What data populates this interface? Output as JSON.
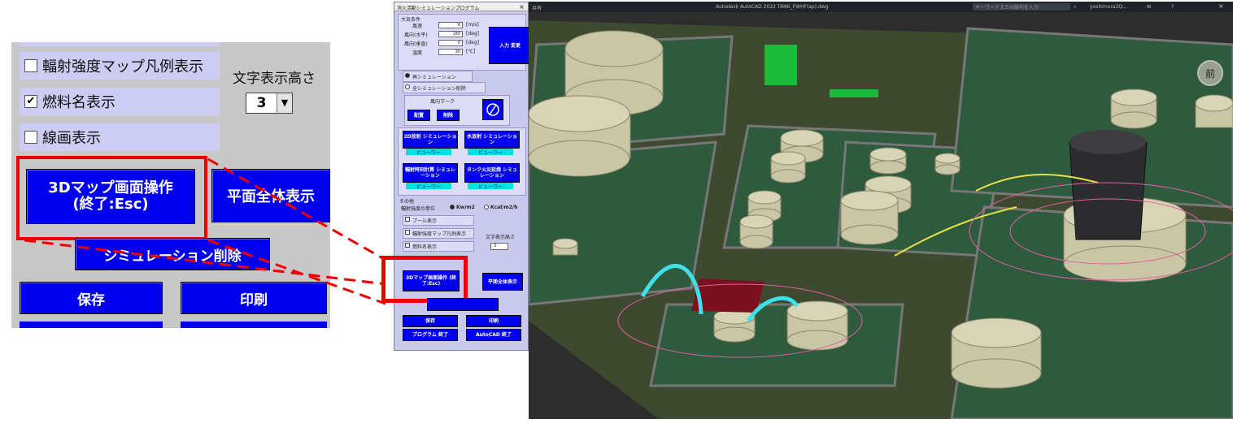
{
  "zoom": {
    "legend_checkbox_label": "輻射強度マップ凡例表示",
    "legend_checked": false,
    "fuel_checkbox_label": "燃料名表示",
    "fuel_checked": true,
    "line_checkbox_label": "線画表示",
    "line_checked": false,
    "text_height_label": "文字表示高さ",
    "text_height_value": "3",
    "map3d_button_line1": "3Dマップ画面操作",
    "map3d_button_line2": "(終了:Esc)",
    "plane_all_button": "平面全体表示",
    "sim_delete_button": "シミュレーション削除",
    "save_button": "保存",
    "print_button": "印刷",
    "check_mark": "✔",
    "dropdown_arrow": "▼"
  },
  "app": {
    "title": "消火活動シミュレーションプログラム",
    "weather_header": "大気条件",
    "fields": [
      {
        "label": "風速",
        "value": "6",
        "unit": "[m/s]"
      },
      {
        "label": "風向(水平)",
        "value": "180",
        "unit": "[deg]"
      },
      {
        "label": "風向(垂直)",
        "value": "0",
        "unit": "[deg]"
      },
      {
        "label": "温度",
        "value": "30",
        "unit": "[℃]"
      }
    ],
    "input_button": "入力 変更",
    "radio1": "再シミュレーション",
    "radio2": "全シミュレーション削除",
    "wind_marker_label": "風向マーク",
    "place_button": "配置",
    "delete_button": "削除",
    "sim1_title": "2D放射 シミュレーション",
    "sim2_title": "水放射 シミュレーション",
    "sim3_title": "輻射時刻計算 シミュレーション",
    "sim4_title": "タンク火災延焼 シミュレーション",
    "viewer_label": "ビューワー",
    "other_header": "その他",
    "unit_label": "輻射強度の単位",
    "unit1": "Kw/m2",
    "unit2": "Kcal/m2/h",
    "opt1": "ブール表示",
    "opt2": "輻射強度マップ凡例表示",
    "opt3": "燃料名表示",
    "text_height_label": "文字表示高さ",
    "text_height_value": "3",
    "map3d_button": "3Dマップ画面操作 (終了:Esc)",
    "plane_all_button": "平面全体表示",
    "save_button": "保存",
    "print_button": "印刷",
    "program_end_button": "プログラム 終了",
    "autocad_end_button": "AutoCAD 終了",
    "close_glyph": "×"
  },
  "cad": {
    "window_title": "Autodesk AutoCAD 2022  TANK_FWHF(ap).dwg",
    "search_placeholder": "キーワードまたは語句を入力",
    "user_label": "yoshimura2Q...",
    "viewcube_label": "前",
    "share_label": "共有"
  }
}
